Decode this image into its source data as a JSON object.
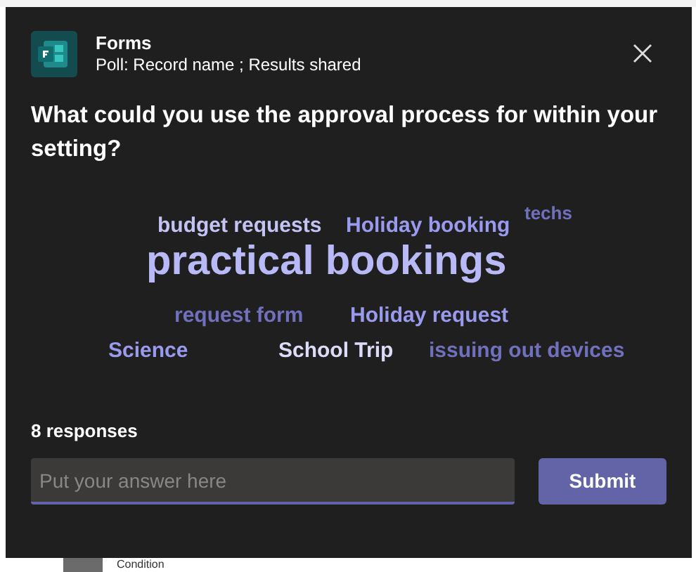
{
  "app": {
    "title": "Forms",
    "subtitle": "Poll: Record name ; Results shared"
  },
  "question": "What could you use the approval process for within your setting?",
  "word_cloud": [
    {
      "text": "budget requests",
      "kind": "medium",
      "color": "#c3c3f4"
    },
    {
      "text": "Holiday booking",
      "kind": "medium",
      "color": "#9a9aee"
    },
    {
      "text": "techs",
      "kind": "small",
      "color": "#7070bd"
    },
    {
      "text": "practical bookings",
      "kind": "large",
      "color": "#b9b9f7"
    },
    {
      "text": "request form",
      "kind": "medium",
      "color": "#7070bd"
    },
    {
      "text": "Holiday request",
      "kind": "medium",
      "color": "#9a9aee"
    },
    {
      "text": "Science",
      "kind": "medium",
      "color": "#9a9aee"
    },
    {
      "text": "School Trip",
      "kind": "medium",
      "color": "#dcdcf8"
    },
    {
      "text": "issuing out devices",
      "kind": "medium",
      "color": "#7070bd"
    }
  ],
  "response_count": "8 responses",
  "answer": {
    "placeholder": "Put your answer here"
  },
  "submit": "Submit",
  "background_row": {
    "label": "Condition"
  }
}
